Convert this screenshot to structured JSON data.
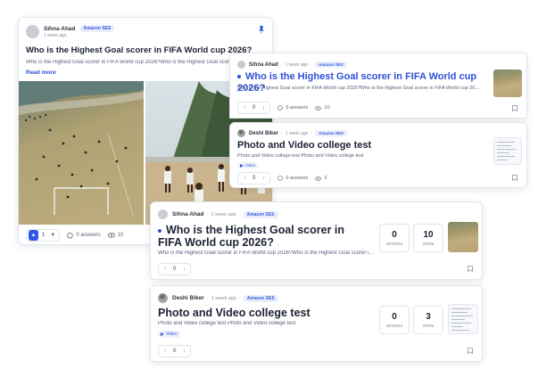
{
  "card1": {
    "user": "Sihna Ahad",
    "time": "1 week ago",
    "badge": "Amazon SES",
    "title": "Who is the Highest Goal scorer in FIFA World cup 2026?",
    "snippet": "Who is the Highest Goal scorer in FIFA World cup 2026?Who is the Highest Goal scorer in FIFA World cup 2026?",
    "read_more": "Read more",
    "votes": "1",
    "answers": "0 answers",
    "views": "10"
  },
  "card2": {
    "user": "Sihna Ahad",
    "time": "1 week ago",
    "badge": "Amazon SES",
    "title": "Who is the Highest Goal scorer in FIFA World cup 2026?",
    "snippet": "Who is the Highest Goal scorer in FIFA World cup 2026?Who is the Highest Goal scorer in FIFA World cup 2026?",
    "votes": "0",
    "answers": "0 answers",
    "views": "10"
  },
  "card3": {
    "user": "Deshi Biker",
    "time": "1 week ago",
    "badge": "Amazon SES",
    "title": "Photo and Video college test",
    "snippet": "Photo and Video college test Photo and Video college test",
    "video_label": "Video",
    "votes": "0",
    "answers": "0 answers",
    "views": "3"
  },
  "card4": {
    "user": "Sihna Ahad",
    "time": "1 week ago",
    "badge": "Amazon SES",
    "title": "Who is the Highest Goal scorer in FIFA World cup 2026?",
    "snippet": "Who is the Highest Goal scorer in FIFA World cup 2026?Who is the Highest Goal scorer in FIFA World cup 2026?",
    "answers_count": "0",
    "answers_label": "answers",
    "views_count": "10",
    "views_label": "views",
    "votes": "0"
  },
  "card5": {
    "user": "Deshi Biker",
    "time": "1 week ago",
    "badge": "Amazon SES",
    "title": "Photo and Video college test",
    "snippet": "Photo and Video college test Photo and Video college test",
    "video_label": "Video",
    "answers_count": "0",
    "answers_label": "answers",
    "views_count": "3",
    "views_label": "views",
    "votes": "0"
  },
  "icons": {
    "pin": "pin-icon",
    "upvote": "arrow-up-icon",
    "downvote": "arrow-down-icon",
    "comment": "comment-icon",
    "eye": "eye-icon",
    "bookmark": "bookmark-icon",
    "play": "play-icon"
  },
  "colors": {
    "accent": "#2f58e8",
    "badge_bg": "#e9eefc",
    "title_blue": "#2f4fd7"
  }
}
